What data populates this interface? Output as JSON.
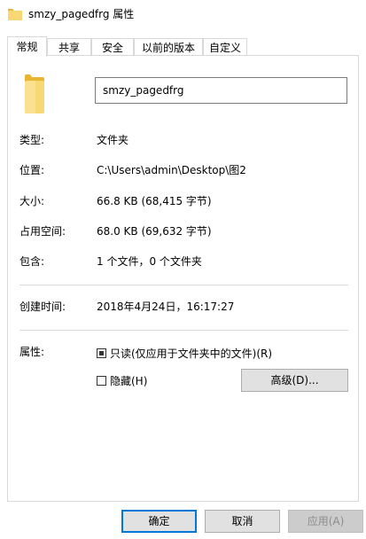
{
  "window": {
    "title": "smzy_pagedfrg 属性"
  },
  "tabs": [
    {
      "label": "常规"
    },
    {
      "label": "共享"
    },
    {
      "label": "安全"
    },
    {
      "label": "以前的版本"
    },
    {
      "label": "自定义"
    }
  ],
  "general": {
    "name_value": "smzy_pagedfrg",
    "type_label": "类型:",
    "type_value": "文件夹",
    "location_label": "位置:",
    "location_value": "C:\\Users\\admin\\Desktop\\图2",
    "size_label": "大小:",
    "size_value": "66.8 KB (68,415 字节)",
    "size_on_disk_label": "占用空间:",
    "size_on_disk_value": "68.0 KB (69,632 字节)",
    "contains_label": "包含:",
    "contains_value": "1 个文件，0 个文件夹",
    "created_label": "创建时间:",
    "created_value": "2018年4月24日，16:17:27",
    "attributes_label": "属性:",
    "readonly_label": "只读(仅应用于文件夹中的文件)(R)",
    "readonly_checked": true,
    "hidden_label": "隐藏(H)",
    "hidden_checked": false,
    "advanced_label": "高级(D)..."
  },
  "footer": {
    "ok_label": "确定",
    "cancel_label": "取消",
    "apply_label": "应用(A)"
  },
  "icons": {
    "title": "folder-icon",
    "large": "folder-icon"
  },
  "colors": {
    "folder": "#f8d775",
    "folder_dark": "#e8b530",
    "primary_border": "#0078d7"
  }
}
